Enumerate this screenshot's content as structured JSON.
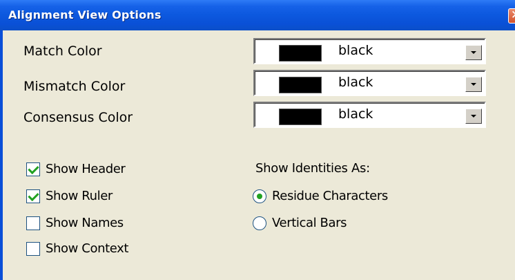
{
  "dialog": {
    "title": "Alignment View Options",
    "close_glyph": "✕"
  },
  "colors": [
    {
      "label": "Match Color",
      "value": "black",
      "swatch": "#000000"
    },
    {
      "label": "Mismatch Color",
      "value": "black",
      "swatch": "#000000"
    },
    {
      "label": "Consensus Color",
      "value": "black",
      "swatch": "#000000"
    }
  ],
  "options": [
    {
      "label": "Show Header",
      "checked": true
    },
    {
      "label": "Show Ruler",
      "checked": true
    },
    {
      "label": "Show Names",
      "checked": false
    },
    {
      "label": "Show Context",
      "checked": false
    }
  ],
  "identities": {
    "label": "Show Identities As:",
    "choices": [
      {
        "label": "Residue Characters",
        "selected": true
      },
      {
        "label": "Vertical Bars",
        "selected": false
      }
    ]
  },
  "theme": {
    "titlebar": "#0A50D6",
    "face": "#ECE9D8",
    "check_accent": "#21A121"
  }
}
